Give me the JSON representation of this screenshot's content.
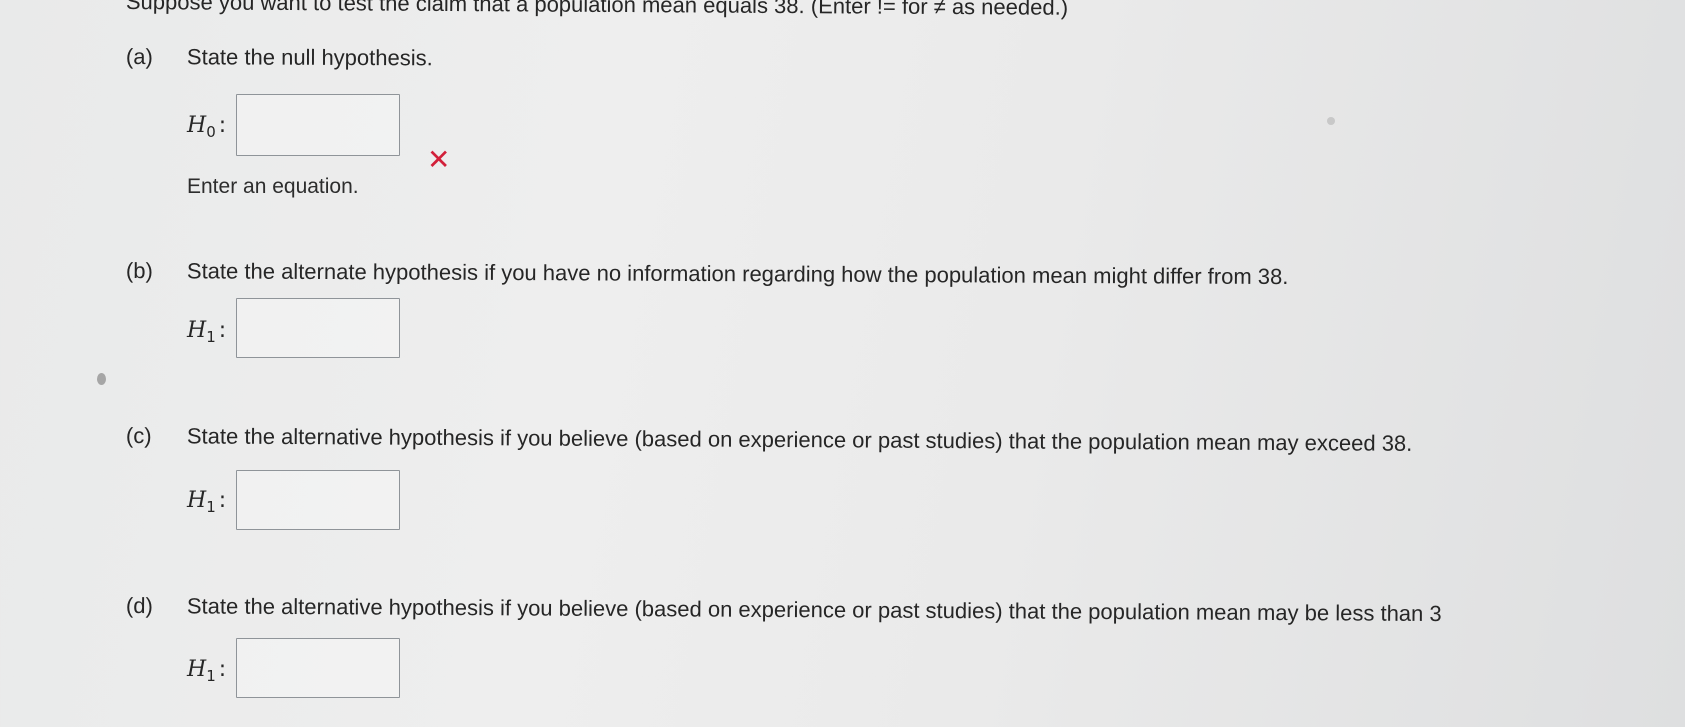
{
  "question": {
    "intro": "Suppose you want to test the claim that a population mean equals 38. (Enter != for ≠ as needed.)"
  },
  "parts": [
    {
      "letter": "(a)",
      "prompt": "State the null hypothesis.",
      "hypothesis_symbol": "H",
      "hypothesis_subscript": "0",
      "colon": ":",
      "answer_value": "",
      "status": "incorrect",
      "feedback": "Enter an equation."
    },
    {
      "letter": "(b)",
      "prompt": "State the alternate hypothesis if you have no information regarding how the population mean might differ from 38.",
      "hypothesis_symbol": "H",
      "hypothesis_subscript": "1",
      "colon": ":",
      "answer_value": ""
    },
    {
      "letter": "(c)",
      "prompt": "State the alternative hypothesis if you believe (based on experience or past studies) that the population mean may exceed 38.",
      "hypothesis_symbol": "H",
      "hypothesis_subscript": "1",
      "colon": ":",
      "answer_value": ""
    },
    {
      "letter": "(d)",
      "prompt": "State the alternative hypothesis if you believe (based on experience or past studies) that the population mean may be less than 3",
      "hypothesis_symbol": "H",
      "hypothesis_subscript": "1",
      "colon": ":",
      "answer_value": ""
    }
  ],
  "icons": {
    "incorrect": "close-icon"
  },
  "colors": {
    "error_red": "#d2203a",
    "text": "#262626",
    "box_border": "#8f9499"
  }
}
